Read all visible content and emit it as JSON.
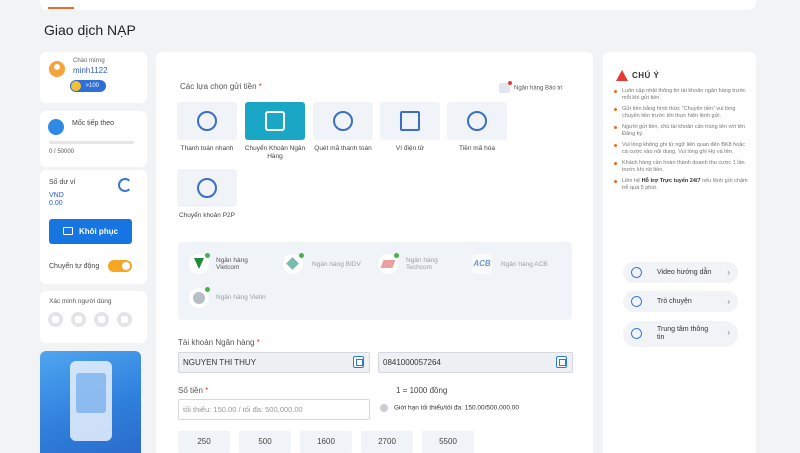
{
  "page_title": "Giao dịch NẠP",
  "user": {
    "greeting": "Chào mừng",
    "username": "minh1122",
    "vip_points": ">100"
  },
  "milestone": {
    "label": "Mốc tiếp theo",
    "progress_text": "0 / 50000",
    "progress_fraction": 0
  },
  "wallet": {
    "label": "Số dư ví",
    "currency": "VND",
    "amount": "0.00",
    "restore_label": "Khôi phục",
    "auto_transfer_label": "Chuyển tự động",
    "auto_transfer_on": true
  },
  "verify": {
    "label": "Xác minh người dùng",
    "icons": [
      "user-icon",
      "email-icon",
      "phone-icon",
      "id-card-icon"
    ]
  },
  "deposit": {
    "options_label": "Các lựa chọn gửi tiền",
    "required_mark": "*",
    "maintenance_label": "Ngân hàng Bảo trì",
    "methods": [
      {
        "label": "Thanh toán nhanh",
        "icon": "fast-pay-icon",
        "active": false
      },
      {
        "label": "Chuyển Khoản Ngân Hàng",
        "icon": "bank-transfer-icon",
        "active": true
      },
      {
        "label": "Quét mã thanh toán",
        "icon": "scan-pay-icon",
        "active": false
      },
      {
        "label": "Ví điện tử",
        "icon": "qr-wallet-icon",
        "active": false
      },
      {
        "label": "Tiền mã hóa",
        "icon": "crypto-icon",
        "active": false
      },
      {
        "label": "Chuyển khoản P2P",
        "icon": "p2p-icon",
        "active": false
      }
    ],
    "banks": [
      {
        "name": "Ngân hàng Vietcom",
        "logo": "vietcombank-logo",
        "selected": true
      },
      {
        "name": "Ngân hàng BIDV",
        "logo": "bidv-logo",
        "selected": false
      },
      {
        "name": "Ngân hàng Techcom",
        "logo": "techcombank-logo",
        "selected": false
      },
      {
        "name": "Ngân hàng ACB",
        "logo_text": "ACB",
        "logo": "acb-logo",
        "selected": false
      },
      {
        "name": "Ngân hàng Vietin",
        "logo": "vietinbank-logo",
        "selected": false
      }
    ],
    "bank_account_label": "Tài khoản Ngân hàng",
    "account_name": "NGUYEN THI THUY",
    "account_number": "0841000057264",
    "amount_label": "Số tiền",
    "amount_placeholder": "tối thiểu: 150.00 / tối đa: 500,000.00",
    "rate_note": "1 = 1000 đồng",
    "limit_note": "Giới hạn tối thiểu/tối đa: 150.00/500,000.00",
    "quick_amounts": [
      "250",
      "500",
      "1600",
      "2700",
      "5500"
    ]
  },
  "notice": {
    "title": "CHÚ Ý",
    "items": [
      "Luôn cập nhật thông tin tài khoản ngân hàng trước mỗi khi gửi tiền.",
      "Gửi tiền bằng hình thức \"Chuyển tiền\" vui lòng chuyển tiền trước khi thực hiện lệnh gửi.",
      "Người gửi tiền, chủ tài khoản cần trùng tên với tên Đăng ký.",
      "Vui lòng không ghi từ ngữ liên quan đến BK8 hoặc cá cược vào nội dung. Vui lòng ghi Họ và tên.",
      "Khách hàng cần hoàn thành doanh thu cược 1 lần trước khi rút tiền."
    ],
    "support_prefix": "Liên hệ ",
    "support_bold": "Hỗ trợ Trực tuyến 24/7",
    "support_suffix": " nếu lệnh gửi chậm trễ quá 5 phút."
  },
  "help_links": [
    {
      "label": "Video hướng dẫn",
      "icon": "video-icon"
    },
    {
      "label": "Trò chuyện",
      "icon": "chat-icon"
    },
    {
      "label": "Trung tâm thông tin",
      "icon": "info-center-icon"
    }
  ],
  "colors": {
    "accent": "#f26a21",
    "primary": "#1675e0",
    "active_method": "#1aa7c6",
    "warning": "#e53935"
  }
}
